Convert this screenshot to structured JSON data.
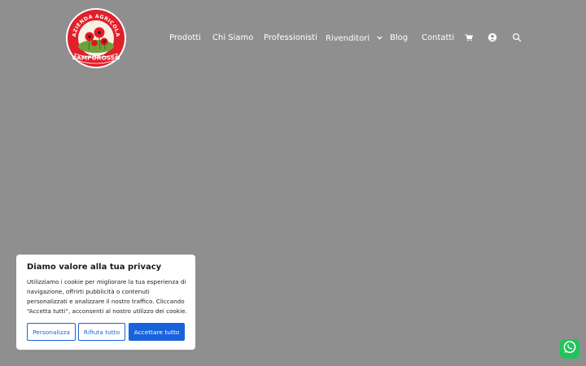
{
  "logo": {
    "arc_text": "AZIENDA AGRICOLA",
    "brand_text": "CAMPOROSSO"
  },
  "nav": {
    "items": [
      "Prodotti",
      "Chi Siamo",
      "Professionisti",
      "Rivenditori",
      "Blog",
      "Contatti"
    ],
    "icons": [
      "cart-icon",
      "user-account-icon",
      "search-icon"
    ]
  },
  "cookie_banner": {
    "title": "Diamo valore alla tua privacy",
    "body": "Utilizziamo i cookie per migliorare la tua esperienza di navigazione, offrirti pubblicità o contenuti personalizzati e analizzare il nostro traffico. Cliccando “Accetta tutti”, acconsenti al nostro utilizzo dei cookie.",
    "customize_label": "Personalizza",
    "reject_label": "Rifiuta tutto",
    "accept_label": "Accettare tutto"
  },
  "colors": {
    "overlay_bg": "#8f8f8f",
    "accent_blue": "#1863dc",
    "whatsapp_green": "#22c25c",
    "logo_red": "#e0202a"
  },
  "floating": {
    "whatsapp_icon": "whatsapp-icon"
  }
}
